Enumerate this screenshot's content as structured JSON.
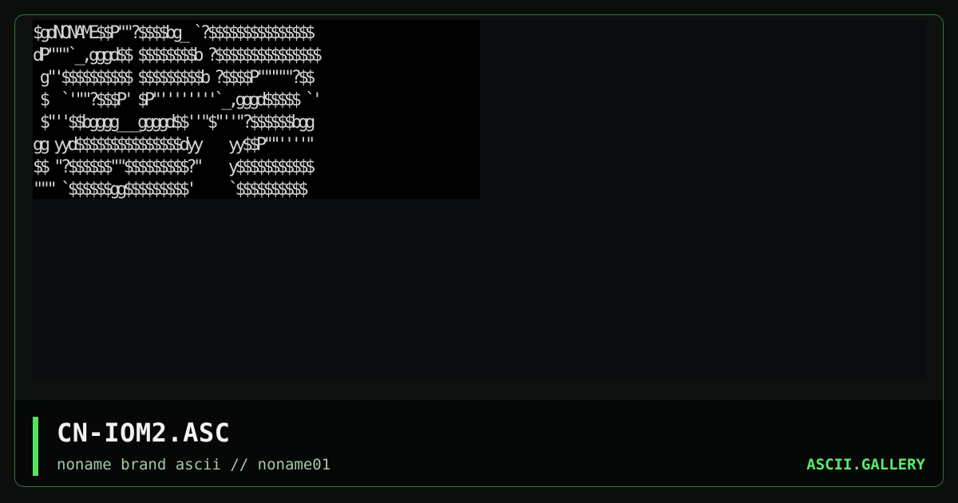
{
  "art": {
    "lines": "$gdNONAME$$P\"\"?$$$$bg_ `?$$$$$$$$$$$$$$$\ndP\"\"\"`_,gggd$$ $$$$$$$$b ?$$$$$$$$$$$$$$$\n g\"'$$$$$$$$$$ $$$$$$$$$b ?$$$$P\"\"\"\"\"?$$\n $  `'\"\"?$$$P' $P\"''''''''`_,gggd$$$$$ `'\n $\"''$$bgggg___ggggd$$''\"$\"''\"?$$$$$$bgg\ngg yyd$$$$$$$$$$$$$$$dyy    yy$$P\"\"''''\"\n$$ \"?$$$$$$\"\"$$$$$$$$$?\"    y$$$$$$$$$$$\n\"\"\" `$$$$$$gg$$$$$$$$$'     `$$$$$$$$$$"
  },
  "caption": {
    "title": "CN-IOM2.ASC",
    "subtitle": "noname brand ascii // noname01",
    "brand": "ASCII.GALLERY"
  },
  "colors": {
    "accent": "#57e05f",
    "brand": "#5fe86a",
    "frame_border": "#2c7a3a",
    "art_text": "#d2d2d2"
  }
}
